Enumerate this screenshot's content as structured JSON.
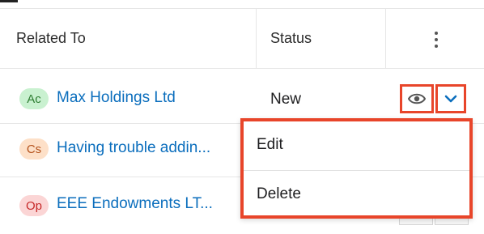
{
  "table": {
    "headers": {
      "related_to": "Related To",
      "status": "Status"
    },
    "rows": [
      {
        "avatar": "Ac",
        "avatar_bg": "#c9f1d0",
        "avatar_fg": "#2e7d32",
        "related": "Max Holdings Ltd",
        "status": "New"
      },
      {
        "avatar": "Cs",
        "avatar_bg": "#fde0c8",
        "avatar_fg": "#b5531d",
        "related": "Having trouble addin...",
        "status": ""
      },
      {
        "avatar": "Op",
        "avatar_bg": "#fbd5d5",
        "avatar_fg": "#c62828",
        "related": "EEE Endowments LT...",
        "status": ""
      }
    ]
  },
  "actions": {
    "preview_icon": "eye-icon",
    "menu_icon": "chevron-down-icon",
    "column_menu_icon": "kebab-icon",
    "menu_items": [
      "Edit",
      "Delete"
    ]
  },
  "colors": {
    "highlight": "#e8452a",
    "link": "#0b6ebd",
    "accent_icon": "#0b6ebd"
  }
}
